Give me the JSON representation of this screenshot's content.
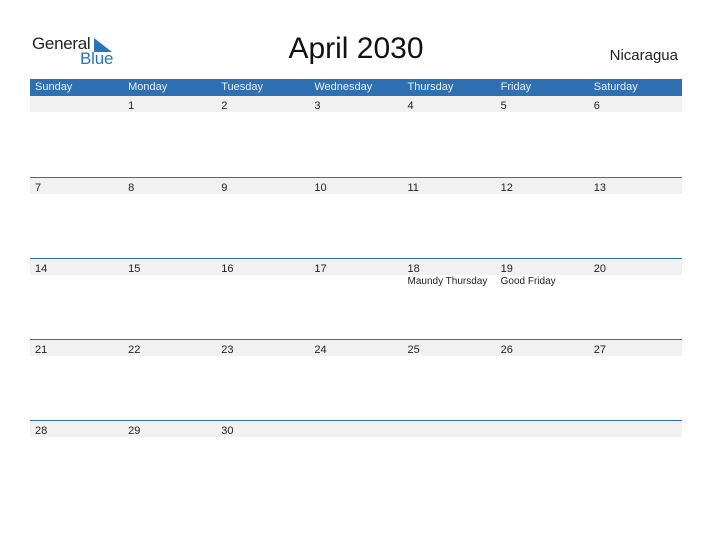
{
  "logo": {
    "part1": "General",
    "part2": "Blue",
    "icon": "triangle-flag-icon"
  },
  "title": "April 2030",
  "country": "Nicaragua",
  "colors": {
    "header_bg": "#2e70b1",
    "strip_bg": "#f1f1f1",
    "brand_blue": "#2a74bb"
  },
  "weekdays": [
    "Sunday",
    "Monday",
    "Tuesday",
    "Wednesday",
    "Thursday",
    "Friday",
    "Saturday"
  ],
  "weeks": [
    {
      "days": [
        "",
        "1",
        "2",
        "3",
        "4",
        "5",
        "6"
      ],
      "events": [
        "",
        "",
        "",
        "",
        "",
        "",
        ""
      ]
    },
    {
      "days": [
        "7",
        "8",
        "9",
        "10",
        "11",
        "12",
        "13"
      ],
      "events": [
        "",
        "",
        "",
        "",
        "",
        "",
        ""
      ]
    },
    {
      "days": [
        "14",
        "15",
        "16",
        "17",
        "18",
        "19",
        "20"
      ],
      "events": [
        "",
        "",
        "",
        "",
        "Maundy Thursday",
        "Good Friday",
        ""
      ]
    },
    {
      "days": [
        "21",
        "22",
        "23",
        "24",
        "25",
        "26",
        "27"
      ],
      "events": [
        "",
        "",
        "",
        "",
        "",
        "",
        ""
      ]
    },
    {
      "days": [
        "28",
        "29",
        "30",
        "",
        "",
        "",
        ""
      ],
      "events": [
        "",
        "",
        "",
        "",
        "",
        "",
        ""
      ]
    }
  ]
}
